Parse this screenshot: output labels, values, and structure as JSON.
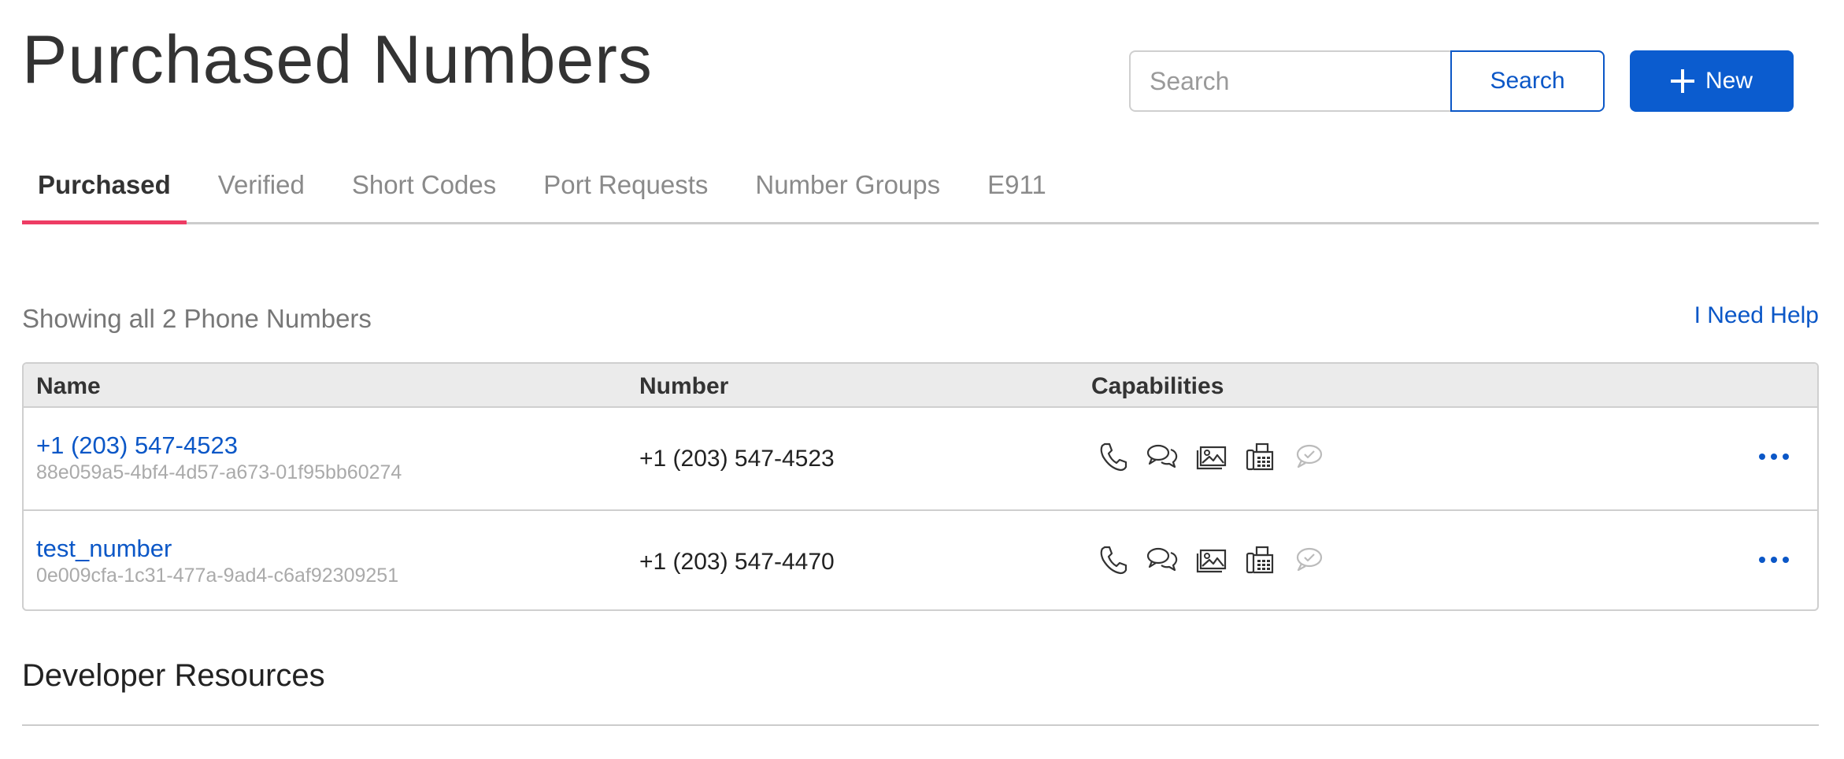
{
  "header": {
    "title": "Purchased Numbers",
    "search_placeholder": "Search",
    "search_button": "Search",
    "new_button": "New"
  },
  "tabs": [
    {
      "label": "Purchased",
      "active": true
    },
    {
      "label": "Verified",
      "active": false
    },
    {
      "label": "Short Codes",
      "active": false
    },
    {
      "label": "Port Requests",
      "active": false
    },
    {
      "label": "Number Groups",
      "active": false
    },
    {
      "label": "E911",
      "active": false
    }
  ],
  "summary": "Showing all 2 Phone Numbers",
  "help_link": "I Need Help",
  "table": {
    "columns": [
      "Name",
      "Number",
      "Capabilities"
    ],
    "rows": [
      {
        "name": "+1 (203) 547-4523",
        "id": "88e059a5-4bf4-4d57-a673-01f95bb60274",
        "number": "+1 (203) 547-4523",
        "capabilities": [
          "voice-icon",
          "sms-icon",
          "mms-icon",
          "fax-icon",
          "verified-message-icon"
        ]
      },
      {
        "name": "test_number",
        "id": "0e009cfa-1c31-477a-9ad4-c6af92309251",
        "number": "+1 (203) 547-4470",
        "capabilities": [
          "voice-icon",
          "sms-icon",
          "mms-icon",
          "fax-icon",
          "verified-message-icon"
        ]
      }
    ]
  },
  "developer_resources": "Developer Resources",
  "colors": {
    "accent": "#0b57c7",
    "tab_active_underline": "#ee3c64",
    "disabled_icon": "#bbbbbb"
  }
}
